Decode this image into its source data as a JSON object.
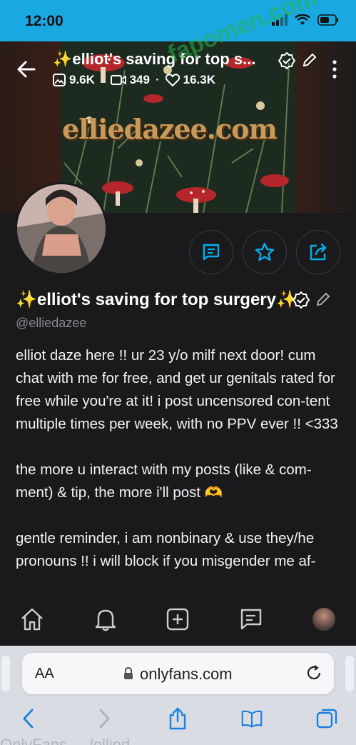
{
  "status": {
    "time": "12:00"
  },
  "nav": {
    "title": "✨elliot's saving for top s...",
    "stats": {
      "images": "9.6K",
      "videos": "349",
      "likes": "16.3K"
    }
  },
  "cover": {
    "watermark": "elliedazee.com"
  },
  "overlay_watermark": "fapomen.com",
  "profile": {
    "name": "✨elliot's saving for top surgery✨",
    "username": "@elliedazee",
    "bio": [
      "elliot daze here !! ur 23 y/o milf next door! cum chat with me for free, and get ur genitals rated for free while you're at it! i post uncensored con-tent multiple times per week, with no PPV ever !! <333",
      "the more u interact with my posts (like & com-ment) & tip, the more i'll post 🫶",
      "gentle reminder, i am nonbinary & use they/he pronouns !! i will block if you misgender me af-"
    ]
  },
  "actions": [
    "message-icon",
    "star-icon",
    "share-icon"
  ],
  "bottom_nav": [
    "home-icon",
    "bell-icon",
    "add-post-icon",
    "chat-icon",
    "profile-avatar"
  ],
  "safari": {
    "aa_label": "AA",
    "url": "onlyfans.com",
    "tab_ghost": "OnlyFans ... /ellied..."
  },
  "colors": {
    "status_bar": "#1aa8e0",
    "accent": "#00aff0",
    "bg": "#1a1a1c"
  }
}
